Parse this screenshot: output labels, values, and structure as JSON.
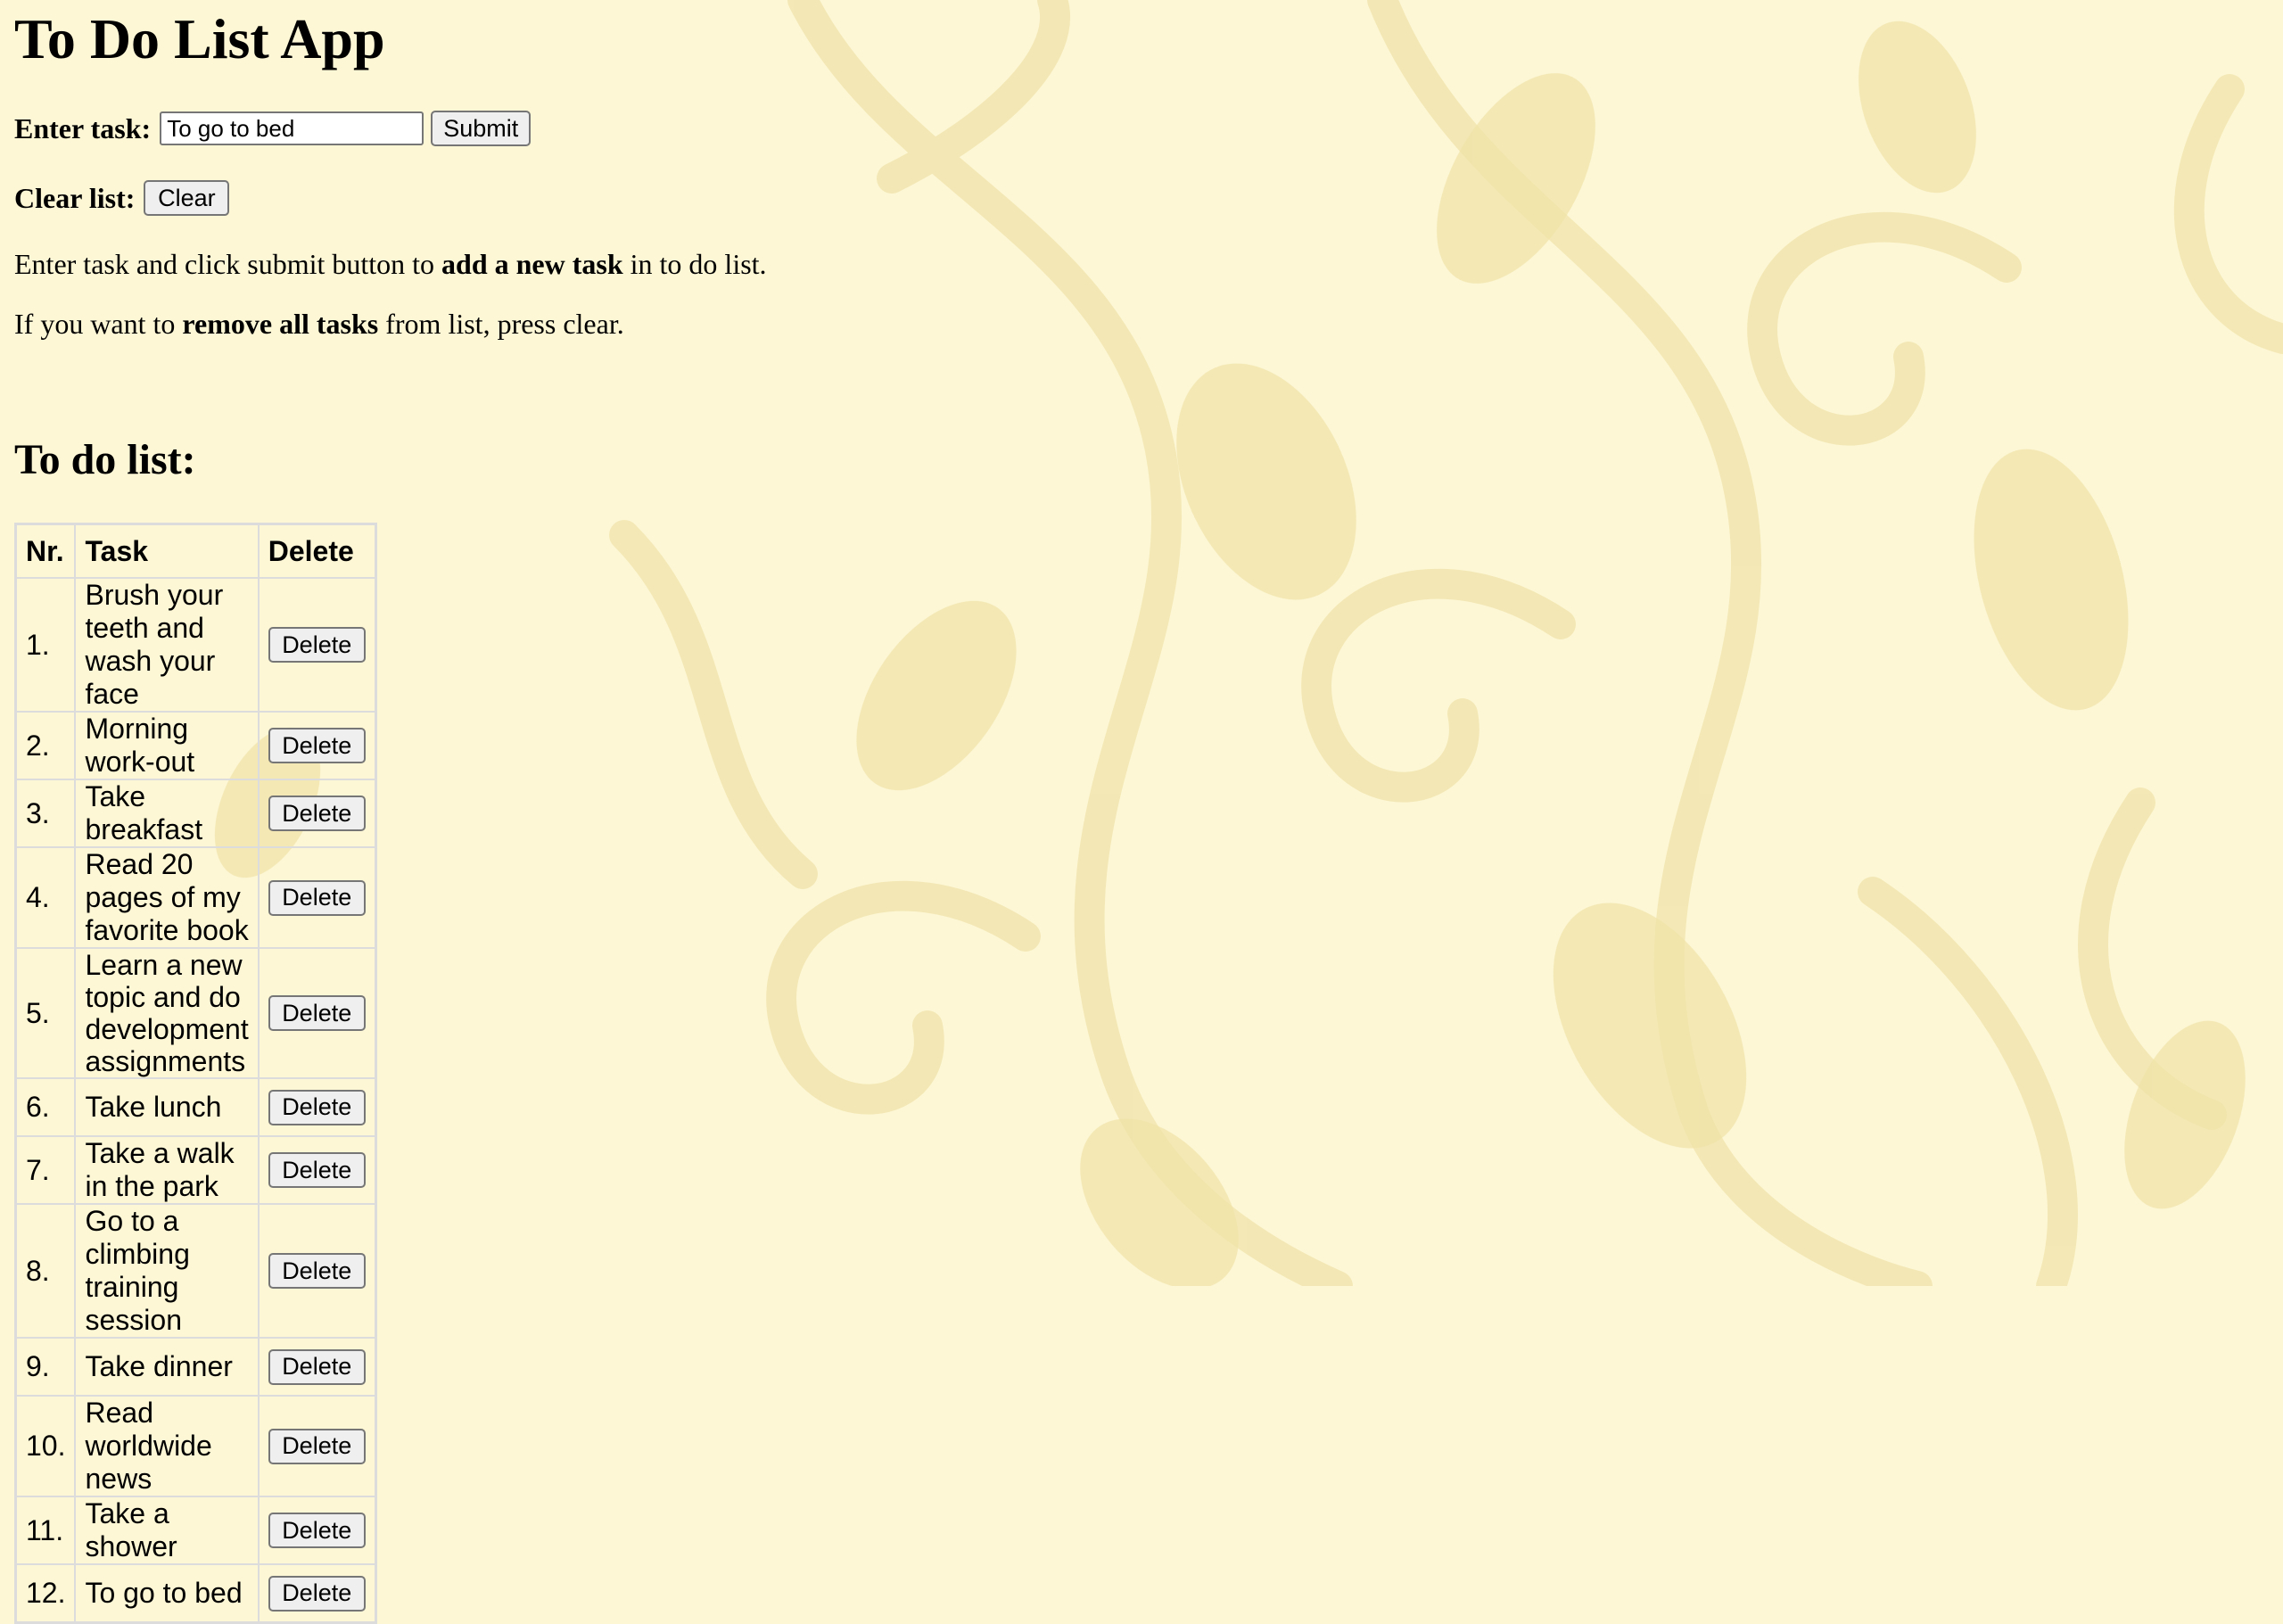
{
  "page": {
    "title": "To Do List App"
  },
  "form": {
    "enter_label": "Enter task:",
    "task_value": "To go to bed",
    "submit_label": "Submit",
    "clear_label": "Clear list:",
    "clear_button": "Clear"
  },
  "info": {
    "line1_pre": "Enter task and click submit button to ",
    "line1_bold": "add a new task",
    "line1_post": " in to do list.",
    "line2_pre": "If you want to ",
    "line2_bold": "remove all tasks",
    "line2_post": " from list, press clear."
  },
  "list": {
    "heading": "To do list:",
    "columns": [
      "Nr.",
      "Task",
      "Delete"
    ],
    "delete_label": "Delete",
    "items": [
      {
        "nr": "1.",
        "task": "Brush your teeth and wash your face"
      },
      {
        "nr": "2.",
        "task": "Morning work-out"
      },
      {
        "nr": "3.",
        "task": "Take breakfast"
      },
      {
        "nr": "4.",
        "task": "Read 20 pages of my favorite book"
      },
      {
        "nr": "5.",
        "task": "Learn a new topic and do development assignments"
      },
      {
        "nr": "6.",
        "task": "Take lunch"
      },
      {
        "nr": "7.",
        "task": "Take a walk in the park"
      },
      {
        "nr": "8.",
        "task": "Go to a climbing training session"
      },
      {
        "nr": "9.",
        "task": "Take dinner"
      },
      {
        "nr": "10.",
        "task": "Read worldwide news"
      },
      {
        "nr": "11.",
        "task": "Take a shower"
      },
      {
        "nr": "12.",
        "task": "To go to bed"
      }
    ]
  },
  "colors": {
    "background": "#fdf7d6",
    "pattern": "#f3e8b4"
  }
}
